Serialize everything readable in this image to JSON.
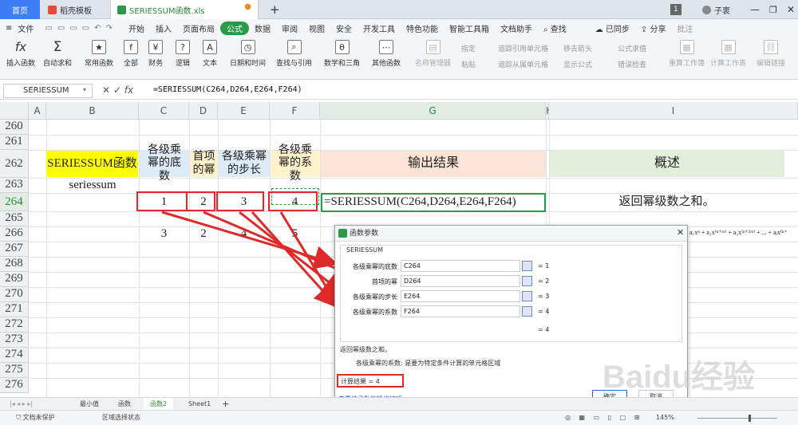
{
  "tabs": {
    "home": "首页",
    "template": "稻壳模板",
    "file": "SERIESSUM函数.xls",
    "new_tab": "+",
    "page_num": "1",
    "user": "子衷"
  },
  "menu": {
    "file": "文件",
    "items": [
      "开始",
      "插入",
      "页面布局",
      "公式",
      "数据",
      "审阅",
      "视图",
      "安全",
      "开发工具",
      "特色功能",
      "智能工具箱",
      "文档助手"
    ],
    "active": "公式",
    "search": "查找",
    "sync": "已同步",
    "share": "分享",
    "annotate": "批注"
  },
  "ribbon": {
    "buttons": [
      "插入函数",
      "自动求和",
      "常用函数",
      "全部",
      "财务",
      "逻辑",
      "文本",
      "日期和时间",
      "查找与引用",
      "数学和三角",
      "其他函数"
    ],
    "disabled": [
      "名称管理器",
      "指定",
      "粘贴",
      "追踪引用单元格",
      "追踪从属单元格",
      "移去箭头",
      "显示公式",
      "公式求值",
      "错误检查",
      "重算工作簿",
      "计算工作表",
      "编辑链接"
    ]
  },
  "formula_bar": {
    "name_box": "SERIESSUM",
    "fx": "fx",
    "formula": "=SERIESSUM(C264,D264,E264,F264)"
  },
  "sheet": {
    "columns": [
      "A",
      "B",
      "C",
      "D",
      "E",
      "F",
      "G",
      "H",
      "I"
    ],
    "rows": [
      "260",
      "261",
      "262",
      "263",
      "264",
      "265",
      "266",
      "267",
      "268",
      "269",
      "270",
      "271",
      "272",
      "273",
      "274",
      "275",
      "276"
    ],
    "header_row": {
      "b": "SERIESSUM函数",
      "c": "各级乘幂的底数",
      "d": "首项的幂",
      "e": "各级乘幂的步长",
      "f": "各级乘幂的系数",
      "g": "输出结果",
      "i": "概述"
    },
    "row263_b": "seriessum",
    "row264": {
      "c": "1",
      "d": "2",
      "e": "3",
      "f": "4",
      "g": "=SERIESSUM(C264,D264,E264,F264)",
      "i": "返回幂级数之和。"
    },
    "row266": {
      "c": "3",
      "d": "2",
      "e": "4",
      "f": "5"
    },
    "formula_preview": "a₁xⁿ + a₂x⁽ⁿ⁺ᵐ⁾ + a₃x⁽ⁿ⁺²ᵐ⁾ + ... + aᵢx⁽ⁿ⁺⁽ⁱ⁻¹⁾ᵐ⁾"
  },
  "dialog": {
    "title": "函数参数",
    "func": "SERIESSUM",
    "args": [
      {
        "label": "各级乘幂的底数",
        "value": "C264",
        "result": "= 1"
      },
      {
        "label": "首项的幂",
        "value": "D264",
        "result": "= 2"
      },
      {
        "label": "各级乘幂的步长",
        "value": "E264",
        "result": "= 3"
      },
      {
        "label": "各级乘幂的系数",
        "value": "F264",
        "result": "= 4"
      }
    ],
    "total": "= 4",
    "description": "返回幂级数之和。",
    "arg_desc": "各级乘幂的系数: 是要为特定条件计算的单元格区域",
    "calc_result": "计算结果 = 4",
    "help_link": "查看该函数的操作技巧",
    "ok": "确定",
    "cancel": "取消"
  },
  "sheet_tabs": [
    "最小值",
    "函数",
    "函数2",
    "Sheet1"
  ],
  "active_sheet": "函数2",
  "status": {
    "protect": "文档未保护",
    "mode": "区域选择状态",
    "zoom": "145%"
  },
  "watermark": "Baidu经验",
  "colors": {
    "yellow": "#ffff00",
    "blue": "#ddebf7",
    "peach": "#fce4d6",
    "green": "#e2efda",
    "accent": "#2a9a4a",
    "red": "#e02a2a"
  }
}
